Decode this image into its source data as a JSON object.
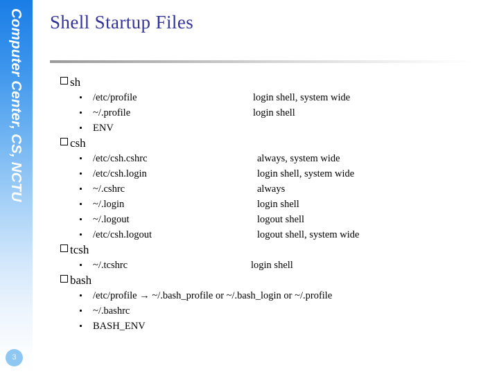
{
  "sidebar": {
    "brand_text": "Computer Center, CS, NCTU",
    "page_number": "3"
  },
  "slide": {
    "title": "Shell Startup Files"
  },
  "sections": [
    {
      "name": "sh",
      "rows": [
        {
          "path": "/etc/profile",
          "desc": "login shell, system wide"
        },
        {
          "path": "~/.profile",
          "desc": "login shell"
        },
        {
          "path": "ENV",
          "desc": ""
        }
      ]
    },
    {
      "name": "csh",
      "rows": [
        {
          "path": "/etc/csh.cshrc",
          "desc": "always, system wide"
        },
        {
          "path": "/etc/csh.login",
          "desc": "login shell, system wide"
        },
        {
          "path": "~/.cshrc",
          "desc": "always"
        },
        {
          "path": "~/.login",
          "desc": "login shell"
        },
        {
          "path": "~/.logout",
          "desc": "logout shell"
        },
        {
          "path": "/etc/csh.logout",
          "desc": "logout shell, system wide"
        }
      ]
    },
    {
      "name": "tcsh",
      "rows": [
        {
          "path": "~/.tcshrc",
          "desc": "login shell"
        }
      ]
    },
    {
      "name": "bash",
      "rows": [
        {
          "path": "/etc/profile → ~/.bash_profile or ~/.bash_login or ~/.profile",
          "desc": ""
        },
        {
          "path": "~/.bashrc",
          "desc": ""
        },
        {
          "path": "BASH_ENV",
          "desc": ""
        }
      ]
    }
  ],
  "colors": {
    "title": "#333399",
    "sidebar_top": "#1a7de6",
    "badge": "#8ec8f2"
  }
}
